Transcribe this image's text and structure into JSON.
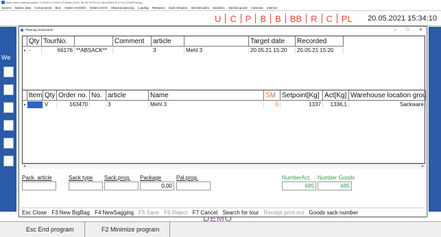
{
  "app": {
    "title": "Main menu loading system V.2024.0.1.2166 8.2024ani [2021-05-30 15:29:21] Jali.Dobehl 8.1174.0 (TestPinning)",
    "menu": [
      "System",
      "Master data",
      "Components",
      "Bins",
      "Orders GOODS",
      "Orders SACK",
      "Material planning",
      "Loading",
      "Releases",
      "Sack releases",
      "Vehiclescales",
      "Statistics",
      "Sacked goods",
      "Cameras",
      "Internet"
    ],
    "status_letters": [
      "U",
      "C",
      "P",
      "B",
      "B",
      "BB",
      "R",
      "C",
      "PL"
    ],
    "clock": "20.05.2021 15:34:10",
    "left_label": "We",
    "demo_mark": "DEMO",
    "bottom_buttons": [
      "Esc End program",
      "F2 Minimize program"
    ]
  },
  "dialog": {
    "title": "Planung Sackwaren",
    "controls": [
      "–",
      "□",
      "✕"
    ],
    "top_grid": {
      "headers": [
        "Qty",
        "TourNo.",
        "Comment",
        "article",
        "",
        "Target date",
        "Recorded"
      ],
      "rows": [
        {
          "marker": "▸",
          "qty": "-",
          "tour": "66176",
          "comment": "**ABSACK**",
          "article": "3",
          "name": "Mehl 3",
          "target": "20.05.21 15:20",
          "recorded": "20.05.21 15:20"
        }
      ]
    },
    "bottom_grid": {
      "headers": [
        "Item",
        "Qty",
        "Order no.",
        "No.",
        "article",
        "Name",
        "SM",
        "Setpoint[Kg]",
        "Act[Kg]",
        "Warehouse location group"
      ],
      "rows": [
        {
          "marker": "▸",
          "item": "",
          "qty": "V",
          "order": "163470",
          "no": "",
          "article": "3",
          "name": "Mehl 3",
          "sm": "0",
          "setpoint": "1337",
          "act": "1336,1",
          "location": "Sackware"
        }
      ]
    },
    "fields": {
      "pack_article": {
        "label": "Pack. article",
        "value": ""
      },
      "sack_type": {
        "label": "Sack type",
        "value": ""
      },
      "sack_prog": {
        "label": "Sack.prog.",
        "value": ""
      },
      "package": {
        "label": "Package",
        "value": "0,00"
      },
      "pal_prog": {
        "label": "Pal.prog.",
        "value": ""
      },
      "number_act": {
        "label": "NumberAct.",
        "value": "685"
      },
      "number_goods": {
        "label": "Number Goods",
        "value": "685"
      }
    },
    "function_keys": [
      {
        "label": "Esc Close",
        "enabled": true
      },
      {
        "label": "F3 New BigBag",
        "enabled": true
      },
      {
        "label": "F4 NewSagging",
        "enabled": true
      },
      {
        "label": "F5 Save",
        "enabled": false
      },
      {
        "label": "F6 Reject",
        "enabled": false
      },
      {
        "label": "F7 Cancel",
        "enabled": true
      },
      {
        "label": "Search for tour",
        "enabled": true
      },
      {
        "label": "Receipt print-out",
        "enabled": false
      },
      {
        "label": "Goods sack number",
        "enabled": true
      }
    ]
  },
  "colors": {
    "accent_red": "#e2473a",
    "selection_blue": "#2b66c8",
    "green": "#3a9a4a",
    "background_blue": "#1f3f7a"
  }
}
